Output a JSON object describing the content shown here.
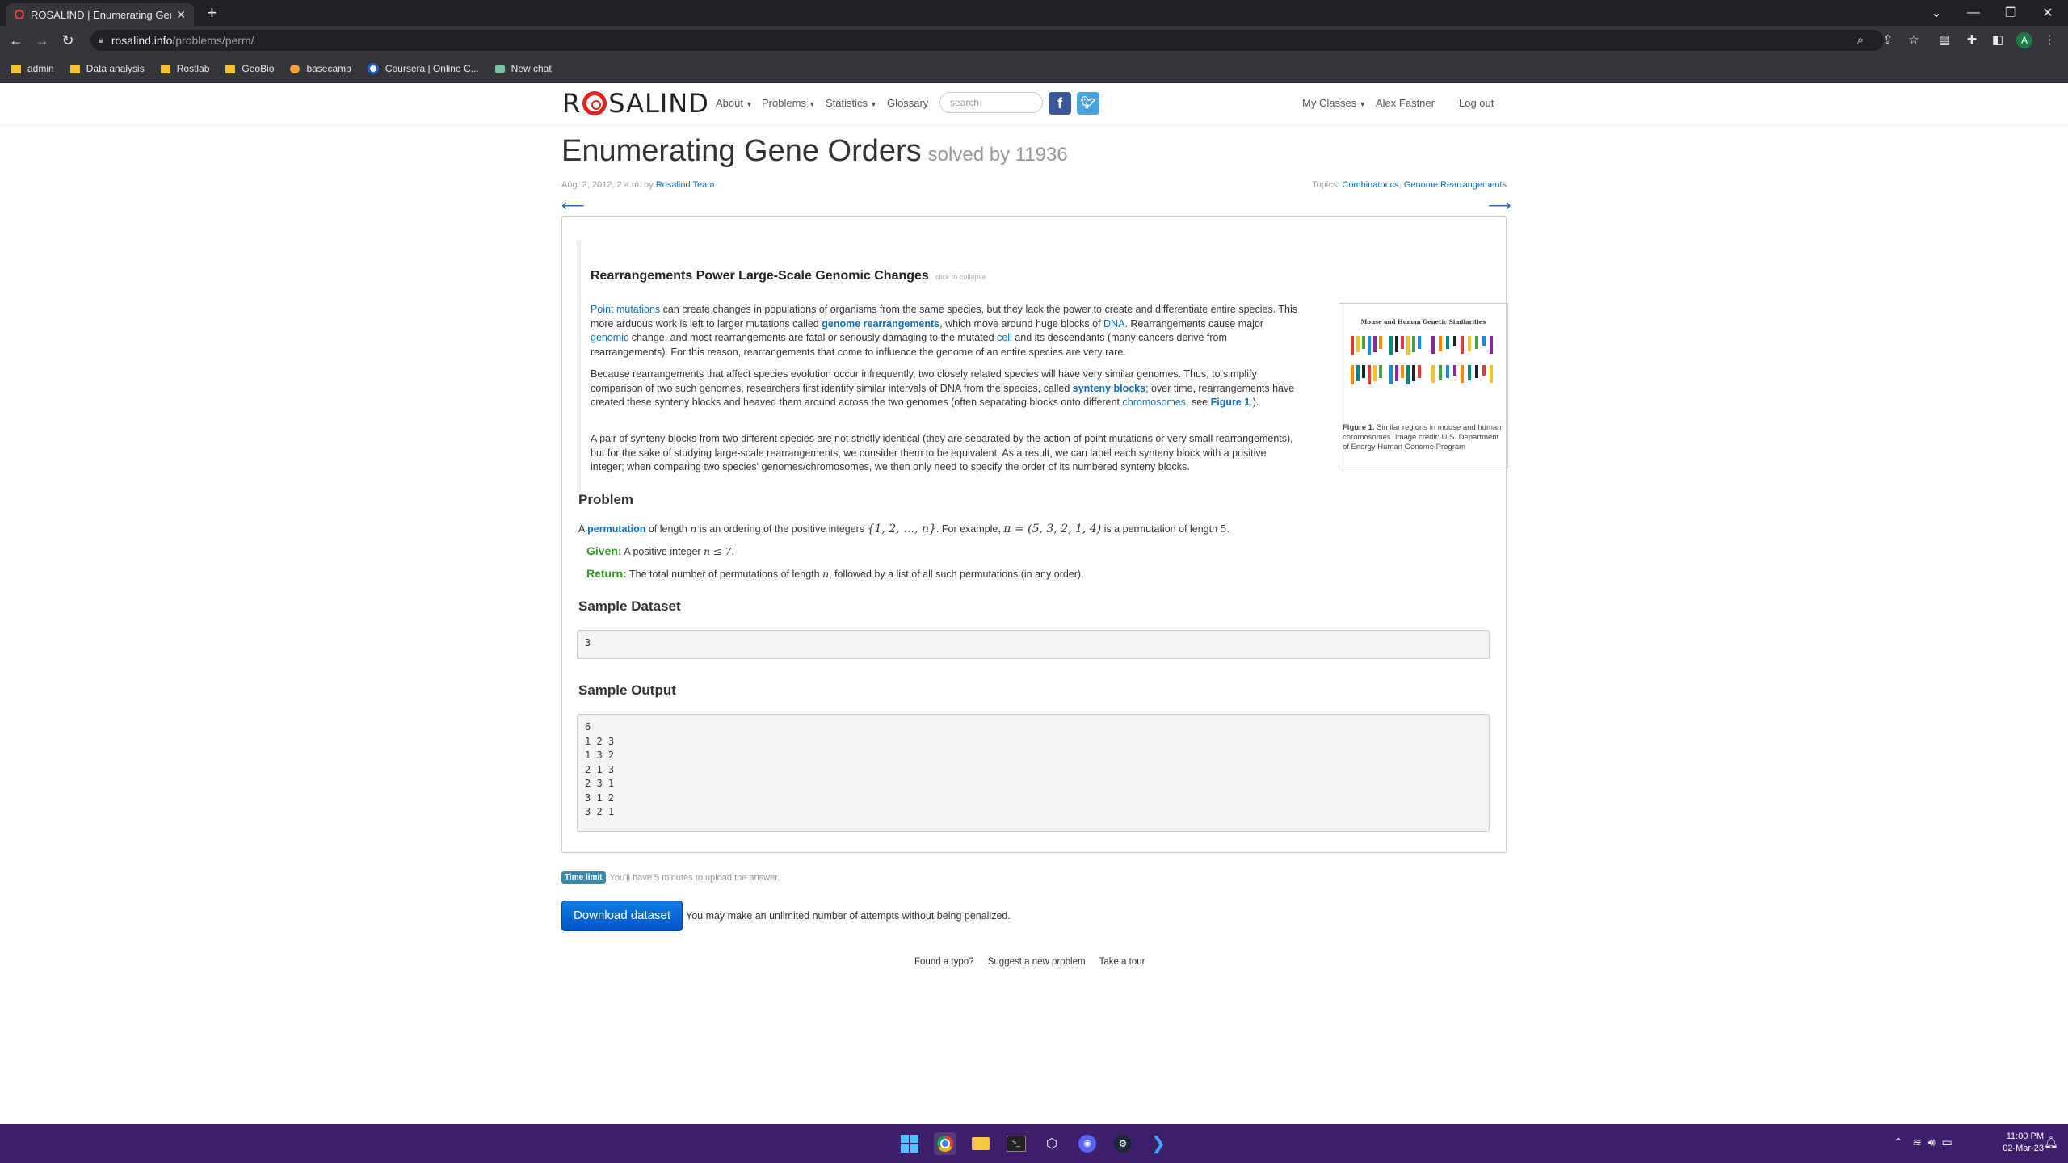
{
  "browser": {
    "tab_title": "ROSALIND | Enumerating Gene C",
    "url_host": "rosalind.info",
    "url_path": "/problems/perm/",
    "bookmarks": [
      {
        "label": "admin",
        "icon": "folder-icon"
      },
      {
        "label": "Data analysis",
        "icon": "folder-icon"
      },
      {
        "label": "Rostlab",
        "icon": "folder-icon"
      },
      {
        "label": "GeoBio",
        "icon": "folder-icon"
      },
      {
        "label": "basecamp",
        "icon": "basecamp-icon"
      },
      {
        "label": "Coursera | Online C...",
        "icon": "coursera-icon"
      },
      {
        "label": "New chat",
        "icon": "chat-icon"
      }
    ]
  },
  "nav": {
    "logo": "ROSALIND",
    "logo_left": "R",
    "logo_right": "SALIND",
    "about": "About",
    "problems": "Problems",
    "statistics": "Statistics",
    "glossary": "Glossary",
    "search_placeholder": "search",
    "my_classes": "My Classes",
    "user": "Alex Fastner",
    "logout": "Log out"
  },
  "problem": {
    "title": "Enumerating Gene Orders",
    "solved": "solved by 11936",
    "date": "Aug. 2, 2012, 2 a.m. by",
    "author": "Rosalind Team",
    "topics_label": "Topics:",
    "topic1": "Combinatorics",
    "topic2": "Genome Rearrangements"
  },
  "intro": {
    "title": "Rearrangements Power Large-Scale Genomic Changes",
    "collapse": "click to collapse",
    "p1": {
      "a": "Point mutations",
      "b": " can create changes in populations of organisms from the same species, but they lack the power to create and differentiate entire species. This more arduous work is left to larger mutations called ",
      "c": "genome rearrangements",
      "d": ", which move around huge blocks of ",
      "e": "DNA",
      "f": ". Rearrangements cause major ",
      "g": "genomic",
      "h": " change, and most rearrangements are fatal or seriously damaging to the mutated ",
      "i": "cell",
      "j": " and its descendants (many cancers derive from rearrangements). For this reason, rearrangements that come to influence the genome of an entire species are very rare."
    },
    "p2": {
      "a": "Because rearrangements that affect species evolution occur infrequently, two closely related species will have very similar genomes. Thus, to simplify comparison of two such genomes, researchers first identify similar intervals of DNA from the species, called ",
      "b": "synteny blocks",
      "c": "; over time, rearrangements have created these synteny blocks and heaved them around across the two genomes (often separating blocks onto different ",
      "d": "chromosomes",
      "e": ", see ",
      "f": "Figure 1",
      "g": ".)."
    },
    "p3": "A pair of synteny blocks from two different species are not strictly identical (they are separated by the action of point mutations or very small rearrangements), but for the sake of studying large-scale rearrangements, we consider them to be equivalent. As a result, we can label each synteny block with a positive integer; when comparing two species' genomes/chromosomes, we then only need to specify the order of its numbered synteny blocks.",
    "figure_title": "Mouse and Human Genetic Similarities",
    "figure_label": "Figure 1.",
    "figure_caption": " Similar regions in mouse and human chromosomes. Image credit: U.S. Department of Energy Human Genome Program"
  },
  "problem_section": {
    "heading": "Problem",
    "s1": "A ",
    "s2": "permutation",
    "s3": " of length ",
    "s4": "n",
    "s5": " is an ordering of the positive integers ",
    "s6": "{1, 2, …, n}",
    "s7": ". For example, ",
    "s8": "π = (5, 3, 2, 1, 4)",
    "s9": " is a permutation of length ",
    "s10": "5",
    "s11": ".",
    "given_label": "Given:",
    "given_text": " A positive integer ",
    "given_math": "n ≤ 7",
    "given_end": ".",
    "return_label": "Return:",
    "return_text": " The total number of permutations of length ",
    "return_math": "n",
    "return_end": ", followed by a list of all such permutations (in any order)."
  },
  "sample": {
    "dataset_heading": "Sample Dataset",
    "dataset": "3",
    "output_heading": "Sample Output",
    "output": "6\n1 2 3\n1 3 2\n2 1 3\n2 3 1\n3 1 2\n3 2 1"
  },
  "actions": {
    "time_badge": "Time limit",
    "time_text": "You'll have 5 minutes to upload the answer.",
    "download": "Download dataset",
    "attempts": "You may make an unlimited number of attempts without being penalized."
  },
  "footer": {
    "typo": "Found a typo?",
    "suggest": "Suggest a new problem",
    "tour": "Take a tour"
  },
  "taskbar": {
    "time": "11:00 PM",
    "date": "02-Mar-23"
  },
  "colors": {
    "link": "#0a6fc2",
    "green": "#319d25",
    "button": "#0055cc",
    "taskbar": "#3e1f6b"
  }
}
